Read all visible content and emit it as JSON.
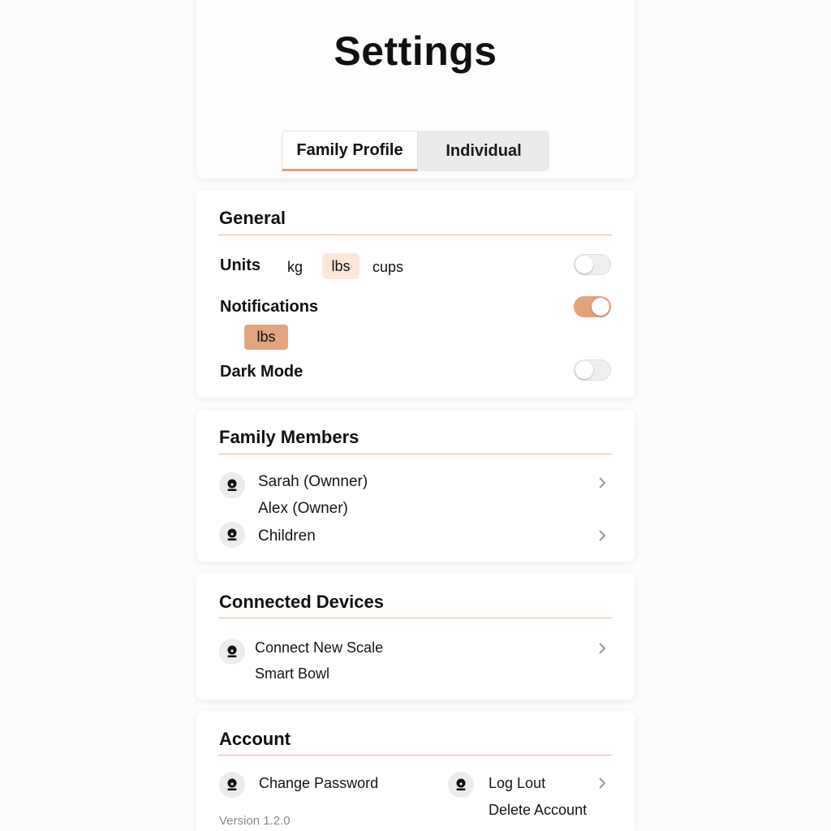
{
  "header": {
    "title": "Settings",
    "tabs": [
      {
        "label": "Family Profile",
        "active": true
      },
      {
        "label": "Individual",
        "active": false
      }
    ]
  },
  "general": {
    "title": "General",
    "units_label": "Units",
    "units_options": [
      "kg",
      "lbs",
      "cups"
    ],
    "units_selected": "lbs",
    "units_toggle_on": false,
    "notifications_label": "Notifications",
    "notifications_toggle_on": true,
    "notifications_chip": "lbs",
    "dark_mode_label": "Dark Mode",
    "dark_mode_toggle_on": false
  },
  "family": {
    "title": "Family Members",
    "items": [
      "Sarah (Ownner)",
      "Alex (Owner)",
      "Children"
    ]
  },
  "devices": {
    "title": "Connected Devices",
    "items": [
      "Connect New Scale",
      "Smart Bowl"
    ]
  },
  "account": {
    "title": "Account",
    "change_password": "Change Password",
    "log_out": "Log Lout",
    "delete_account": "Delete Account",
    "version": "Version 1.2.0"
  },
  "colors": {
    "accent": "#e2a27c",
    "accent_light": "#fde7d8",
    "divider": "#eab795"
  },
  "icons": {
    "avatar": "person-icon",
    "chevron": "chevron-right-icon"
  }
}
